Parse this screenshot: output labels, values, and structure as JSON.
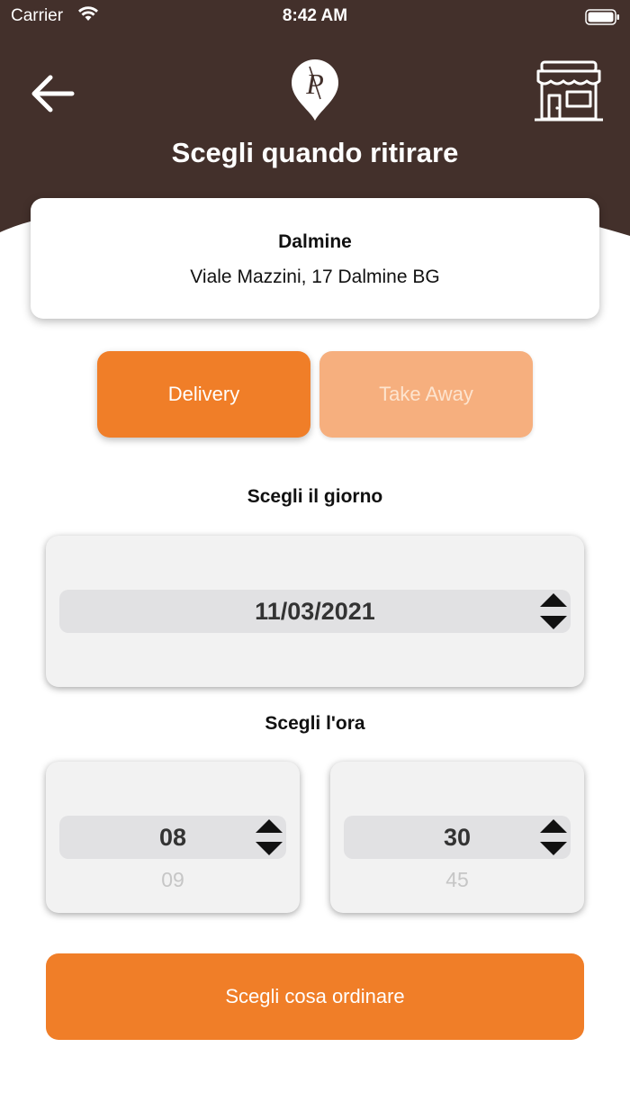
{
  "status_bar": {
    "carrier": "Carrier",
    "time": "8:42 AM"
  },
  "header": {
    "title": "Scegli quando ritirare",
    "logo_letter": "P"
  },
  "store": {
    "name": "Dalmine",
    "address": "Viale Mazzini, 17 Dalmine BG"
  },
  "mode_toggle": {
    "delivery_label": "Delivery",
    "takeaway_label": "Take Away",
    "selected": "Delivery"
  },
  "day_section": {
    "label": "Scegli il giorno",
    "selected_date": "11/03/2021"
  },
  "time_section": {
    "label": "Scegli l'ora",
    "hour": {
      "selected": "08",
      "next": "09"
    },
    "minute": {
      "selected": "30",
      "next": "45"
    }
  },
  "cta": {
    "label": "Scegli cosa ordinare"
  },
  "colors": {
    "header_brown": "#43302B",
    "accent_orange": "#F07E28",
    "accent_orange_light": "#F6AF7E"
  },
  "icons": [
    "back-arrow-icon",
    "location-pin-logo-icon",
    "store-icon",
    "wifi-icon",
    "battery-icon",
    "stepper-arrows-icon"
  ]
}
